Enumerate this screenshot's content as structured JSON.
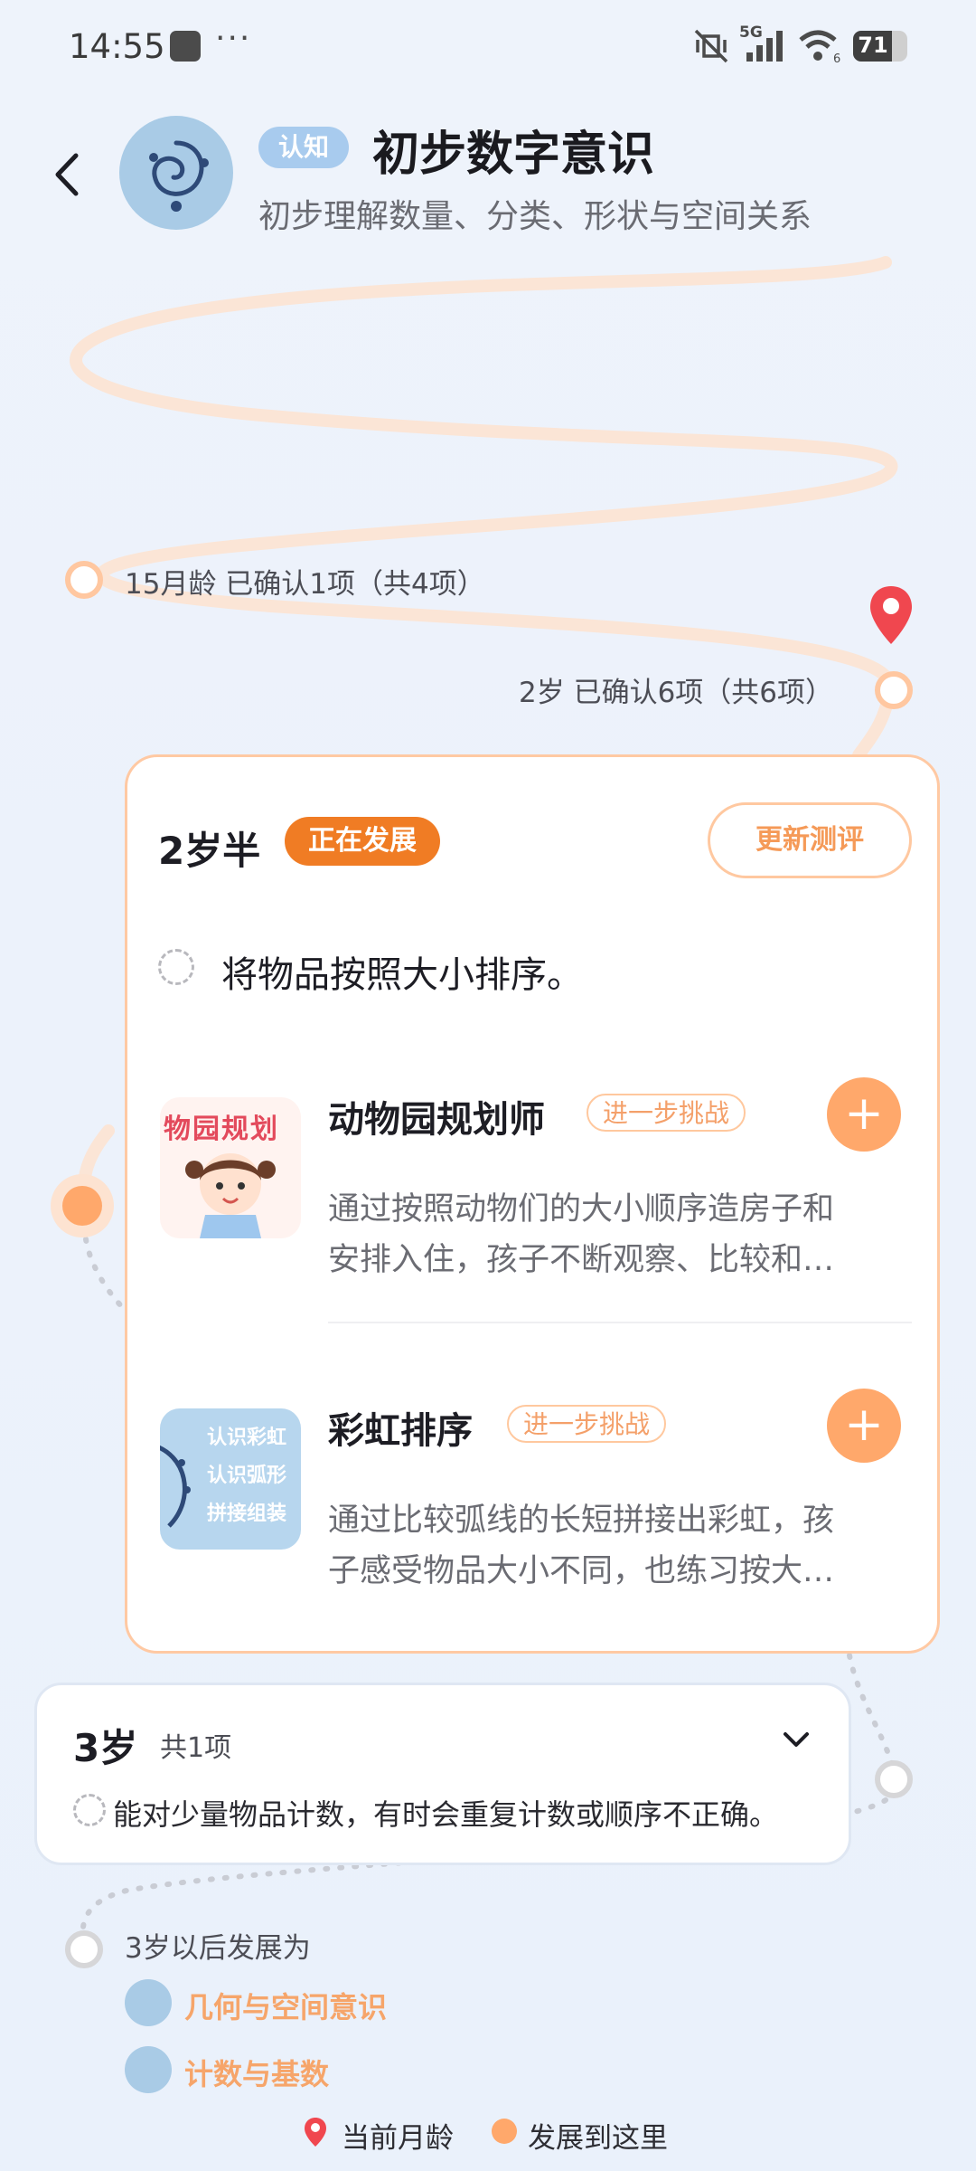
{
  "status_bar": {
    "time": "14:55",
    "more": "···",
    "network": "5G",
    "wifi_level": "6",
    "battery": "71"
  },
  "header": {
    "back_label": "返回",
    "tag": "认知",
    "title": "初步数字意识",
    "subtitle": "初步理解数量、分类、形状与空间关系"
  },
  "timeline": {
    "milestones": [
      {
        "label": "15月龄 已确认1项（共4项）"
      },
      {
        "label": "2岁 已确认6项（共6项）"
      }
    ]
  },
  "current_card": {
    "age": "2岁半",
    "status": "正在发展",
    "update_button": "更新测评",
    "goal": "将物品按照大小排序。",
    "activities": [
      {
        "title": "动物园规划师",
        "chip": "进一步挑战",
        "desc_line1": "通过按照动物们的大小顺序造房子和",
        "desc_line2": "安排入住，孩子不断观察、比较和…",
        "thumb_text": "物园规划"
      },
      {
        "title": "彩虹排序",
        "chip": "进一步挑战",
        "desc_line1": "通过比较弧线的长短拼接出彩虹，孩",
        "desc_line2": "子感受物品大小不同，也练习按大…",
        "thumb_text_1": "认识彩虹",
        "thumb_text_2": "认识弧形",
        "thumb_text_3": "拼接组装"
      }
    ]
  },
  "next_card": {
    "age": "3岁",
    "count": "共1项",
    "goal": "能对少量物品计数，有时会重复计数或顺序不正确。"
  },
  "future": {
    "label": "3岁以后发展为",
    "links": [
      "几何与空间意识",
      "计数与基数"
    ]
  },
  "legend": {
    "current_age": "当前月龄",
    "developed_here": "发展到这里"
  },
  "colors": {
    "accent_orange": "#f07c24",
    "soft_orange": "#ffa86b",
    "pin_red": "#f0474f",
    "tag_blue": "#a8cbee",
    "background": "#eef3fb"
  }
}
